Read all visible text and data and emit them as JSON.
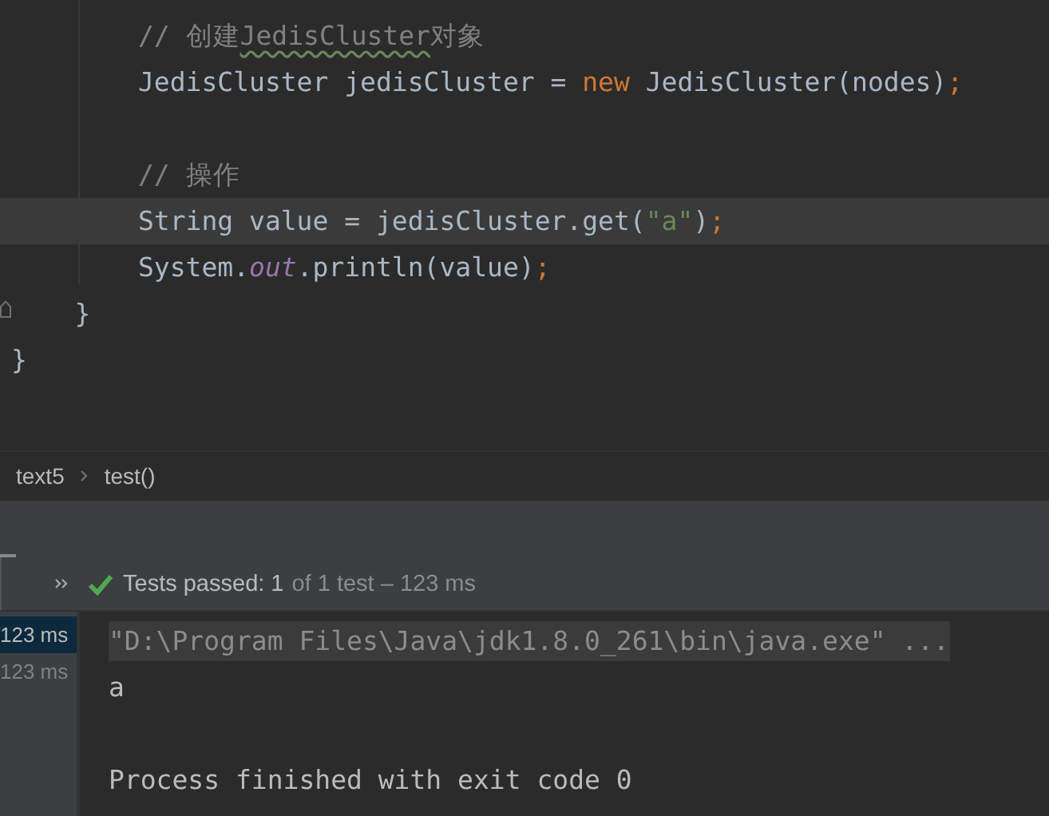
{
  "editor": {
    "lines": [
      {
        "current": false,
        "tokens": [
          {
            "kind": "comment",
            "text": "        // 创建"
          },
          {
            "kind": "comment-typo",
            "text": "JedisCluster"
          },
          {
            "kind": "comment",
            "text": "对象"
          }
        ]
      },
      {
        "current": false,
        "tokens": [
          {
            "kind": "plain",
            "text": "        JedisCluster jedisCluster = "
          },
          {
            "kind": "keyword",
            "text": "new"
          },
          {
            "kind": "plain",
            "text": " JedisCluster(nodes)"
          },
          {
            "kind": "punct",
            "text": ";"
          }
        ]
      },
      {
        "current": false
      },
      {
        "current": false,
        "tokens": [
          {
            "kind": "comment",
            "text": "        // 操作"
          }
        ]
      },
      {
        "current": true,
        "tokens": [
          {
            "kind": "plain",
            "text": "        String value = jedisCluster.get("
          },
          {
            "kind": "string",
            "text": "\"a\""
          },
          {
            "kind": "plain",
            "text": ")"
          },
          {
            "kind": "punct",
            "text": ";"
          }
        ]
      },
      {
        "current": false,
        "tokens": [
          {
            "kind": "plain",
            "text": "        System."
          },
          {
            "kind": "static",
            "text": "out"
          },
          {
            "kind": "plain",
            "text": ".println(value)"
          },
          {
            "kind": "punct",
            "text": ";"
          }
        ]
      },
      {
        "current": false,
        "tokens": [
          {
            "kind": "plain",
            "text": "    }"
          }
        ]
      },
      {
        "current": false,
        "tokens": [
          {
            "kind": "plain",
            "text": "}"
          }
        ]
      }
    ]
  },
  "breadcrumbs": [
    "text5",
    "test()"
  ],
  "run_panel": {
    "status": {
      "summary": "Tests passed: 1",
      "detail": "of 1 test – 123 ms"
    },
    "tree": [
      {
        "label": "123 ms",
        "selected": true
      },
      {
        "label": "123 ms",
        "selected": false
      }
    ],
    "console": [
      {
        "kind": "command",
        "text": "\"D:\\Program Files\\Java\\jdk1.8.0_261\\bin\\java.exe\" ..."
      },
      {
        "kind": "output",
        "text": "a"
      },
      {
        "kind": "blank"
      },
      {
        "kind": "output",
        "text": "Process finished with exit code 0"
      }
    ]
  }
}
